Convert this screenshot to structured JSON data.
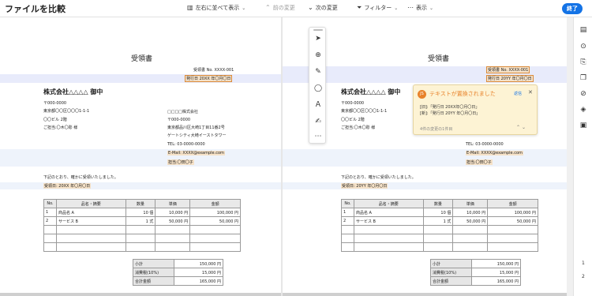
{
  "header": {
    "title": "ファイルを比較",
    "side_by_side": "左右に並べて表示",
    "prev_change": "前の変更",
    "next_change": "次の変更",
    "filter": "フィルター",
    "view": "表示",
    "end_button": "終了"
  },
  "doc": {
    "title": "受領書",
    "receipt_no": "受領書 No. XXXX-001",
    "issue_date_old": "発行日 20XX 年〇月〇日",
    "issue_date_new": "発行日 20YY 年〇月〇日",
    "recipient": "株式会社△△△△ 御中",
    "recipient_postal": "〒000-0000",
    "recipient_address": "東京都〇〇区〇〇〇1-1-1",
    "recipient_building": "〇〇ビル 2階",
    "recipient_contact": "ご担当:〇木〇彫 様",
    "sender_company": "□□□□株式会社",
    "sender_postal": "〒000-0000",
    "sender_address": "東京都品川区大崎1丁目11番2号",
    "sender_building": "ゲートシティ大崎イーストタワー",
    "sender_tel": "TEL: 03-0000-0000",
    "sender_email": "E-Mail: XXXX@example.com",
    "sender_person": "担当:〇田〇子",
    "received_text": "下記のとおり、確かに受領いたしました。",
    "received_date_old": "受領日: 20XX 年〇月〇日",
    "received_date_new": "受領日: 20YY 年〇月〇日",
    "table_headers": [
      "No.",
      "品名・摘要",
      "数量",
      "単価",
      "金額"
    ],
    "rows": [
      [
        "1",
        "商品名 A",
        "10 個",
        "10,000 円",
        "100,000 円"
      ],
      [
        "2",
        "サービス B",
        "1 式",
        "50,000 円",
        "50,000 円"
      ],
      [
        "",
        "",
        "",
        "",
        ""
      ],
      [
        "",
        "",
        "",
        "",
        ""
      ],
      [
        "",
        "",
        "",
        "",
        ""
      ]
    ],
    "summary": [
      [
        "小計",
        "150,000 円"
      ],
      [
        "消費税(10%)",
        "15,000 円"
      ],
      [
        "合計金額",
        "165,000 円"
      ]
    ]
  },
  "comment": {
    "avatar": "JS",
    "heading": "テキストが置換されました",
    "reply": "返信",
    "old_line": "[旧]:「発行日 20XX年〇月〇日」",
    "new_line": "[新]:「発行日 20YY 年〇月〇日」",
    "nav_text": "4件の変更の1件目"
  },
  "pages": [
    "1",
    "2"
  ],
  "colors": {
    "accent": "#1473e6",
    "change_band": "#e8ebfb",
    "highlight_fill": "#f6e2c8",
    "highlight_border": "#d98a3a",
    "comment_bg": "#fdf3d4",
    "comment_accent": "#e8822a"
  },
  "icons": {
    "side_by_side": "compare-columns-icon",
    "filter": "filter-icon",
    "view": "more-horizontal-icon",
    "tools": [
      "select-arrow-icon",
      "zoom-icon",
      "pencil-icon",
      "lasso-icon",
      "text-box-icon",
      "fill-sign-icon",
      "more-icon"
    ],
    "sidebar": [
      "comment-icon",
      "search-icon",
      "bookmark-icon",
      "copy-icon",
      "link-icon",
      "layers-icon",
      "save-icon"
    ]
  }
}
